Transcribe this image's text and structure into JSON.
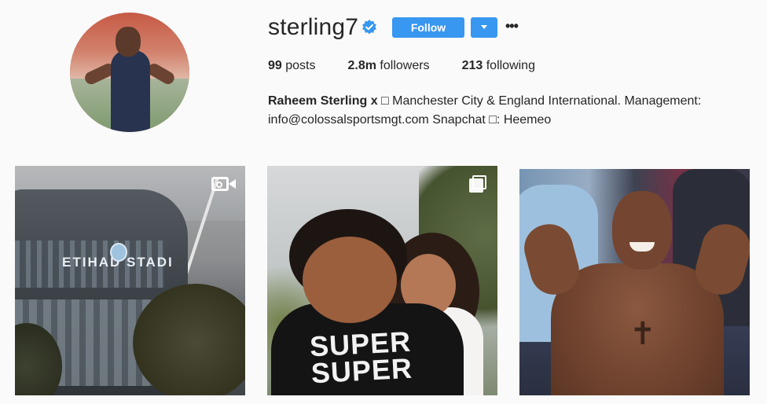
{
  "profile": {
    "username": "sterling7",
    "verified": true,
    "follow_label": "Follow",
    "more_label": "•••",
    "accent_color": "#3897f0"
  },
  "stats": {
    "posts_count": "99",
    "posts_label": "posts",
    "followers_count": "2.8m",
    "followers_label": "followers",
    "following_count": "213",
    "following_label": "following"
  },
  "bio": {
    "name": "Raheem Sterling x □",
    "line1": "Manchester City & England International. Management:",
    "line2": "info@colossalsportsmgt.com Snapchat □: Heemeo"
  },
  "posts": [
    {
      "type_icon": "video-icon",
      "sign_text": "ETIHAD STADI"
    },
    {
      "type_icon": "carousel-icon",
      "shirt_text_line1": "SUPER",
      "shirt_text_line2": "SUPER"
    },
    {
      "type_icon": "none"
    }
  ]
}
